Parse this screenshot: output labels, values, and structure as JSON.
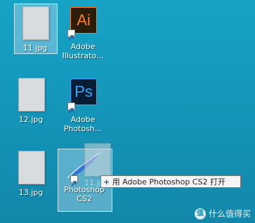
{
  "desktop": {
    "icons": [
      {
        "label": "11.jpg",
        "type": "image-file-icon"
      },
      {
        "label": "Adobe Illustrato...",
        "type": "illustrator-shortcut-icon",
        "app_glyph": "Ai"
      },
      {
        "label": "12.jpg",
        "type": "image-file-icon"
      },
      {
        "label": "Adobe Photosh...",
        "type": "photoshop-shortcut-icon",
        "app_glyph": "Ps"
      },
      {
        "label": "13.jpg",
        "type": "image-file-icon"
      },
      {
        "label": "Photoshop CS2",
        "type": "photoshop-cs2-shortcut-icon"
      }
    ],
    "drag_ghost_label": "11.jpg"
  },
  "tooltip": {
    "prefix": "+",
    "text": "用 Adobe Photoshop CS2 打开"
  },
  "watermark": {
    "text": "什么值得买",
    "logo_glyph": "值"
  },
  "colors": {
    "illustrator": "#ff7f18",
    "photoshop": "#31a8ff",
    "selection": "#afd7eb"
  }
}
